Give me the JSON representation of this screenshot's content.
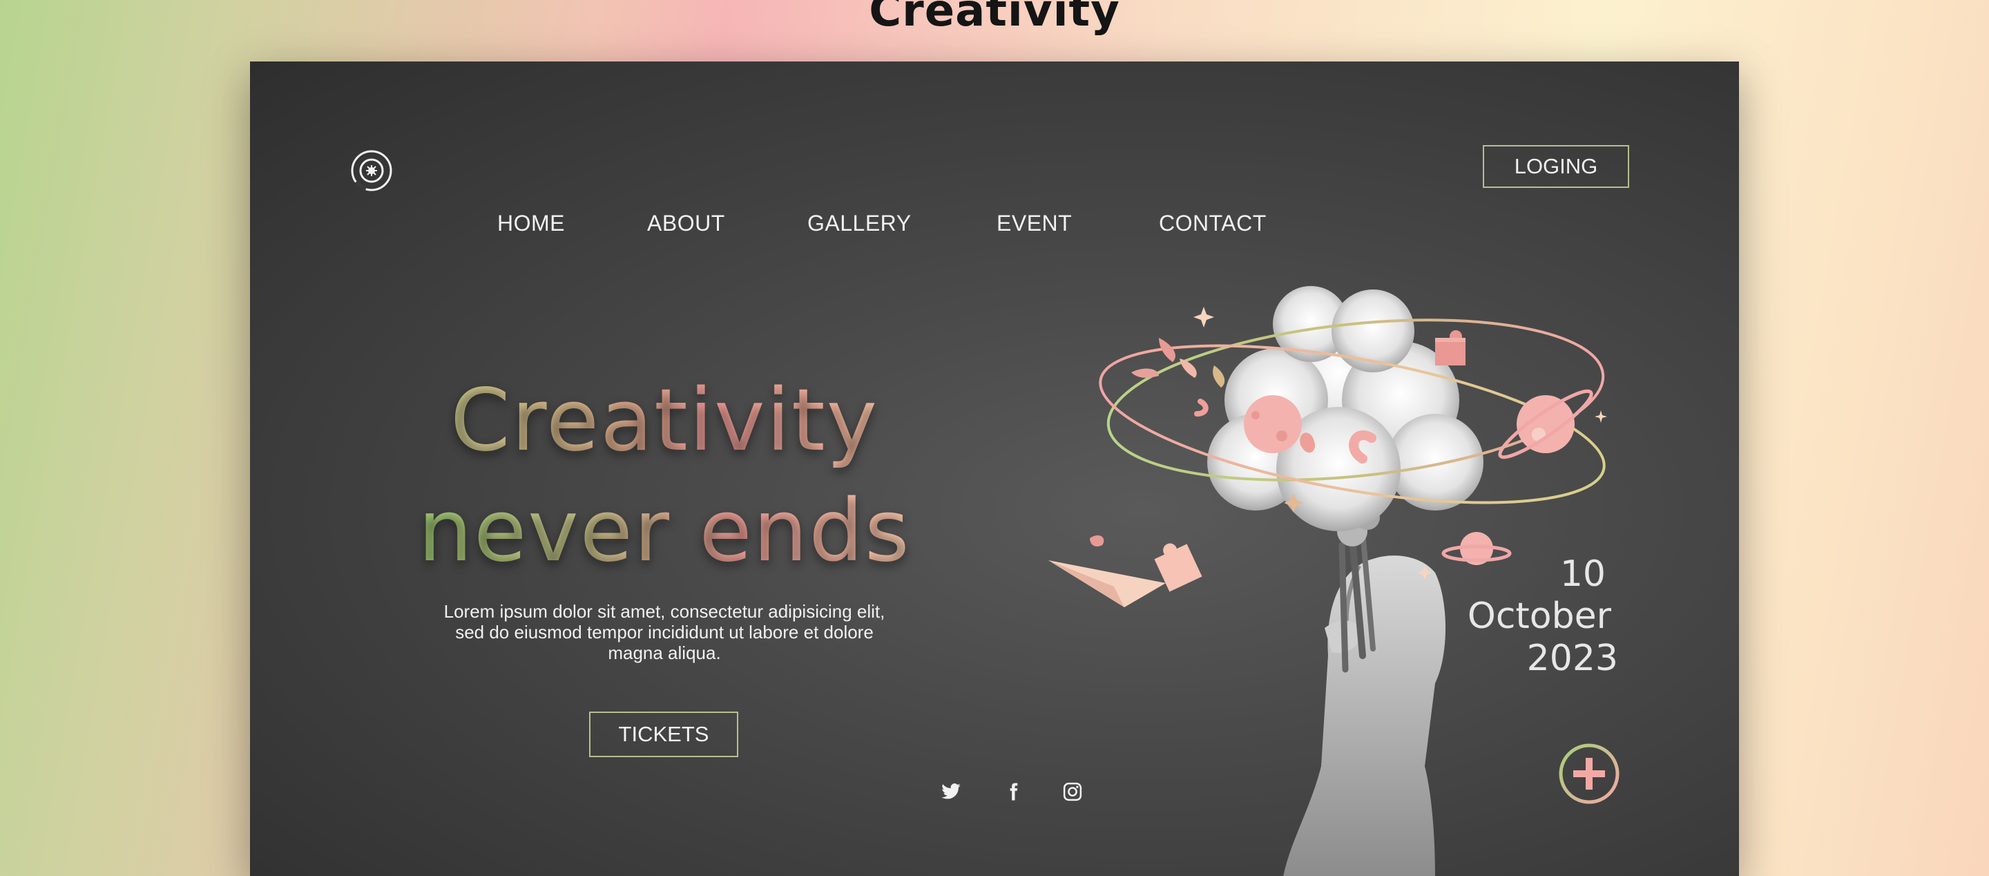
{
  "page": {
    "title": "Creativity"
  },
  "nav": {
    "items": [
      "HOME",
      "ABOUT",
      "GALLERY",
      "EVENT",
      "CONTACT"
    ],
    "login_label": "LOGING"
  },
  "hero": {
    "headline_line1": "Creativity",
    "headline_line2": "never ends",
    "description": "Lorem ipsum dolor sit amet, consectetur adipisicing elit, sed do eiusmod tempor incididunt ut labore et dolore magna aliqua.",
    "tickets_label": "TICKETS"
  },
  "event_date": {
    "day": "10",
    "month": "October",
    "year": "2023"
  },
  "social": [
    "twitter-icon",
    "facebook-icon",
    "instagram-icon"
  ],
  "colors": {
    "accent_green": "#b8bf8e",
    "accent_pink": "#ef9a96",
    "accent_peach": "#f7c9a4",
    "card_background": "#3b3b3b"
  }
}
